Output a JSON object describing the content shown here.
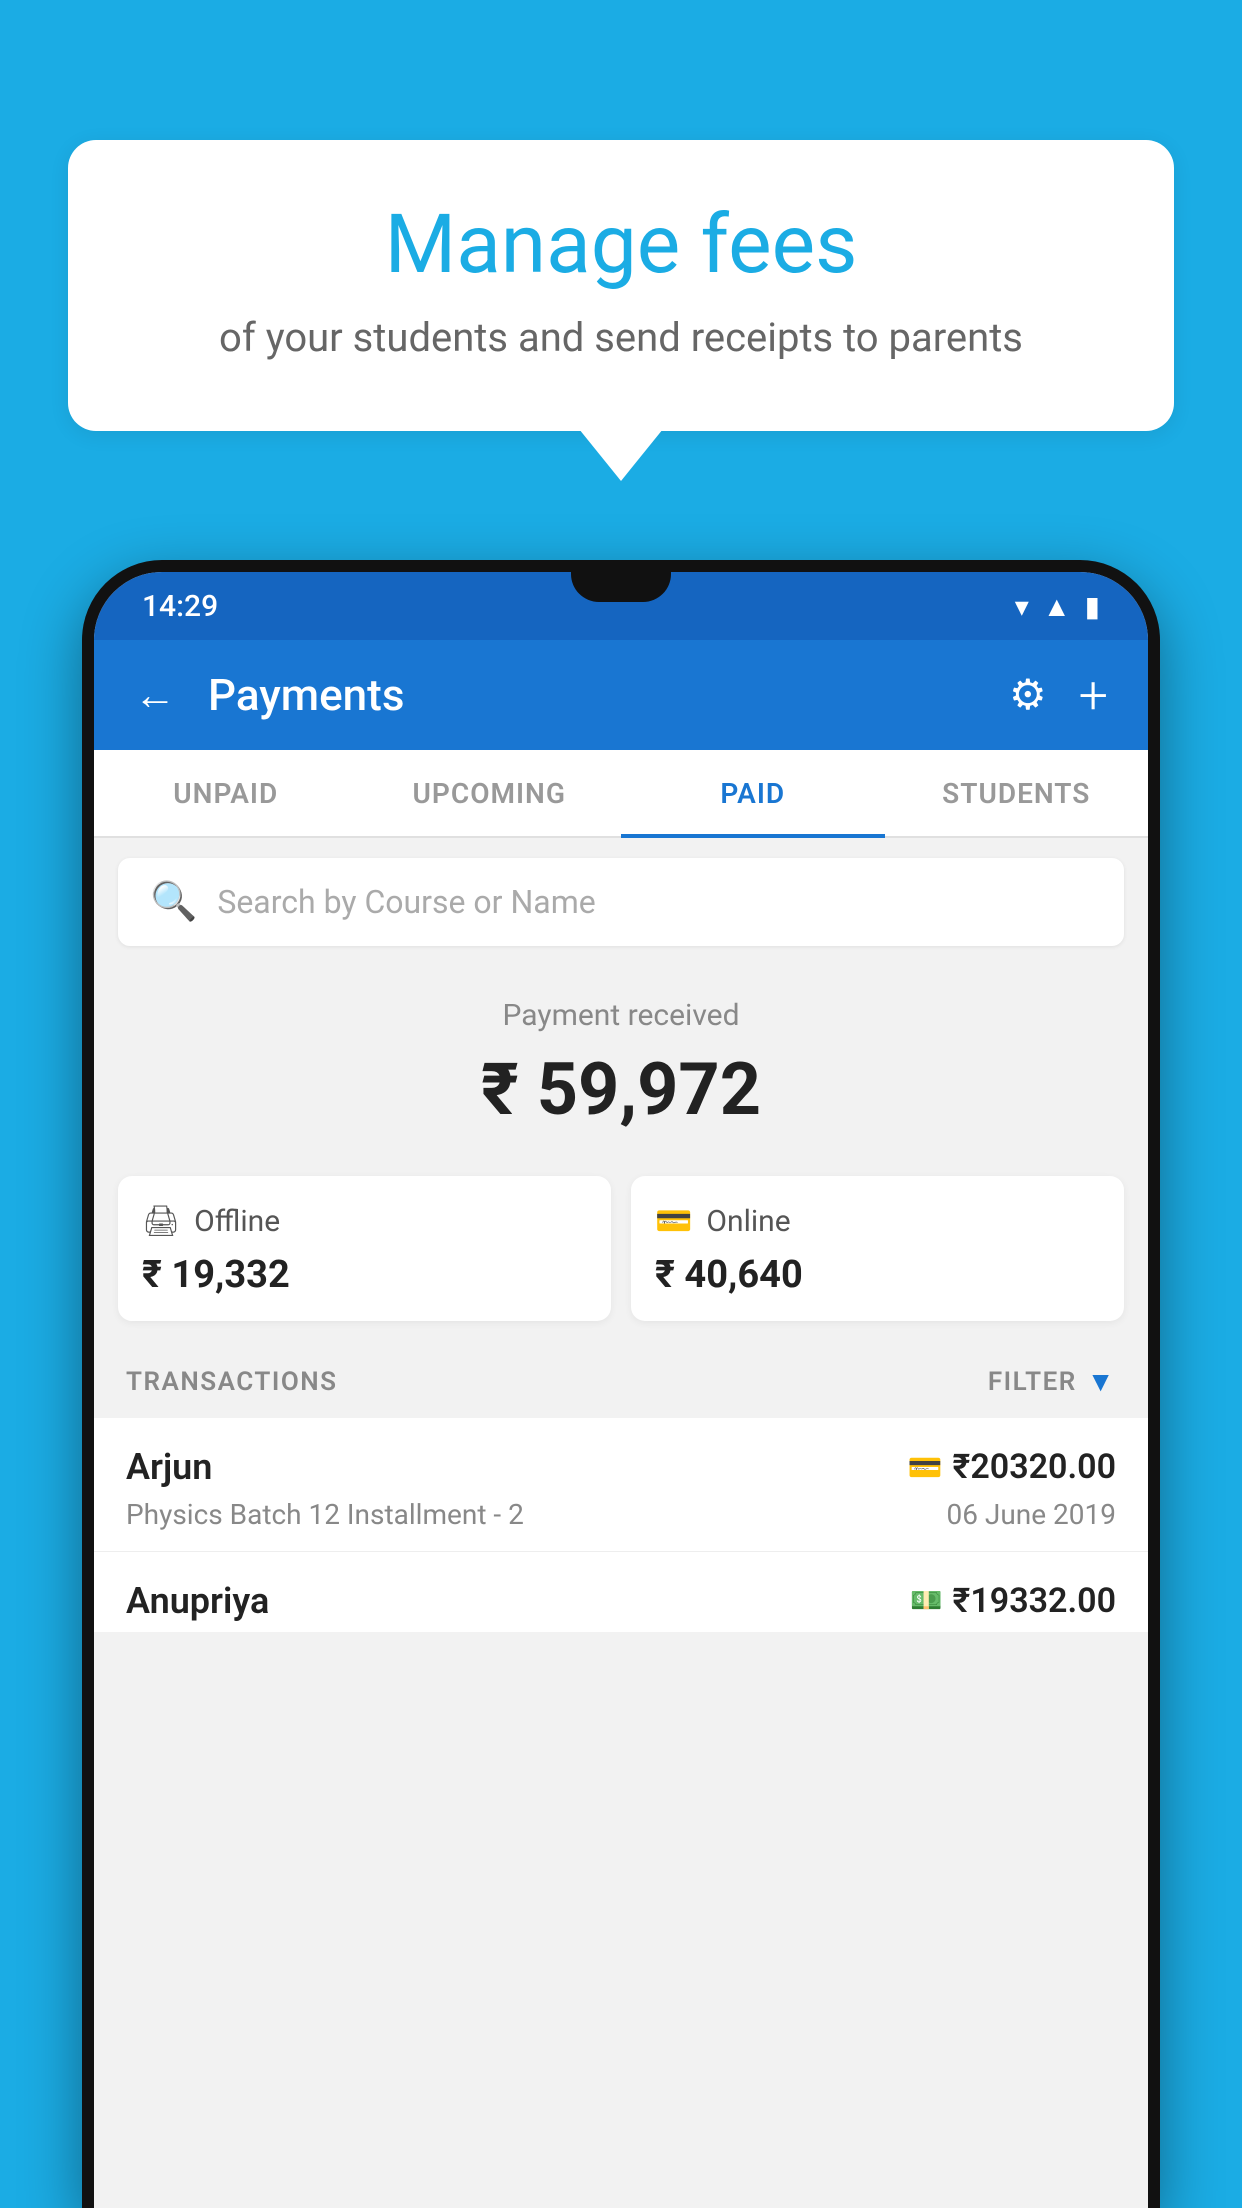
{
  "background_color": "#1BACE4",
  "speech_bubble": {
    "title": "Manage fees",
    "subtitle": "of your students and send receipts to parents"
  },
  "status_bar": {
    "time": "14:29",
    "icons": [
      "wifi",
      "signal",
      "battery"
    ]
  },
  "app_bar": {
    "title": "Payments",
    "back_icon": "←",
    "settings_icon": "⚙",
    "add_icon": "+"
  },
  "tabs": [
    {
      "label": "UNPAID",
      "active": false
    },
    {
      "label": "UPCOMING",
      "active": false
    },
    {
      "label": "PAID",
      "active": true
    },
    {
      "label": "STUDENTS",
      "active": false
    }
  ],
  "search": {
    "placeholder": "Search by Course or Name"
  },
  "payment_received": {
    "label": "Payment received",
    "amount": "₹ 59,972",
    "offline": {
      "type": "Offline",
      "amount": "₹ 19,332"
    },
    "online": {
      "type": "Online",
      "amount": "₹ 40,640"
    }
  },
  "transactions": {
    "header_label": "TRANSACTIONS",
    "filter_label": "FILTER",
    "items": [
      {
        "name": "Arjun",
        "amount": "₹20320.00",
        "payment_icon": "card",
        "course": "Physics Batch 12 Installment - 2",
        "date": "06 June 2019"
      },
      {
        "name": "Anupriya",
        "amount": "₹19332.00",
        "payment_icon": "cash",
        "course": "",
        "date": ""
      }
    ]
  }
}
